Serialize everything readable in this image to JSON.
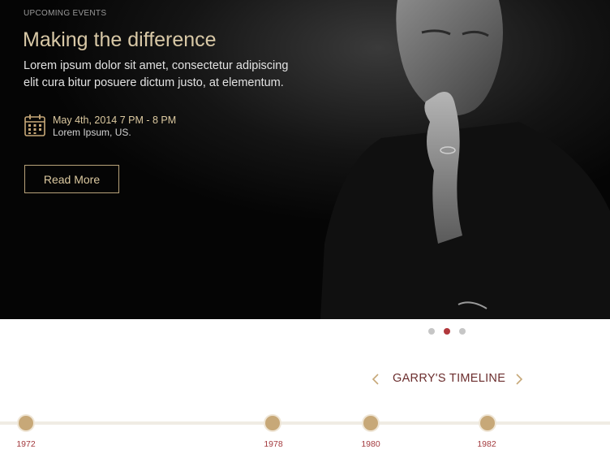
{
  "hero": {
    "eyebrow": "UPCOMING EVENTS",
    "title": "Making the difference",
    "description": "Lorem ipsum dolor sit amet, consectetur adipiscing elit cura bitur posuere dictum justo, at elementum.",
    "event": {
      "date": "May 4th, 2014 7 PM - 8 PM",
      "location": "Lorem Ipsum, US.",
      "icon": "calendar-icon"
    },
    "button_label": "Read More",
    "image": "portrait-photo"
  },
  "carousel": {
    "slides": 3,
    "active_index": 1
  },
  "timeline": {
    "title": "GARRY'S TIMELINE",
    "prev_icon": "chevron-left-icon",
    "next_icon": "chevron-right-icon",
    "items": [
      {
        "year": "1972"
      },
      {
        "year": "1978"
      },
      {
        "year": "1980"
      },
      {
        "year": "1982"
      }
    ]
  },
  "colors": {
    "accent_gold": "#c7a878",
    "accent_red": "#b1383c",
    "headline": "#d8c8a6",
    "timeline_title": "#6b2d2d"
  }
}
